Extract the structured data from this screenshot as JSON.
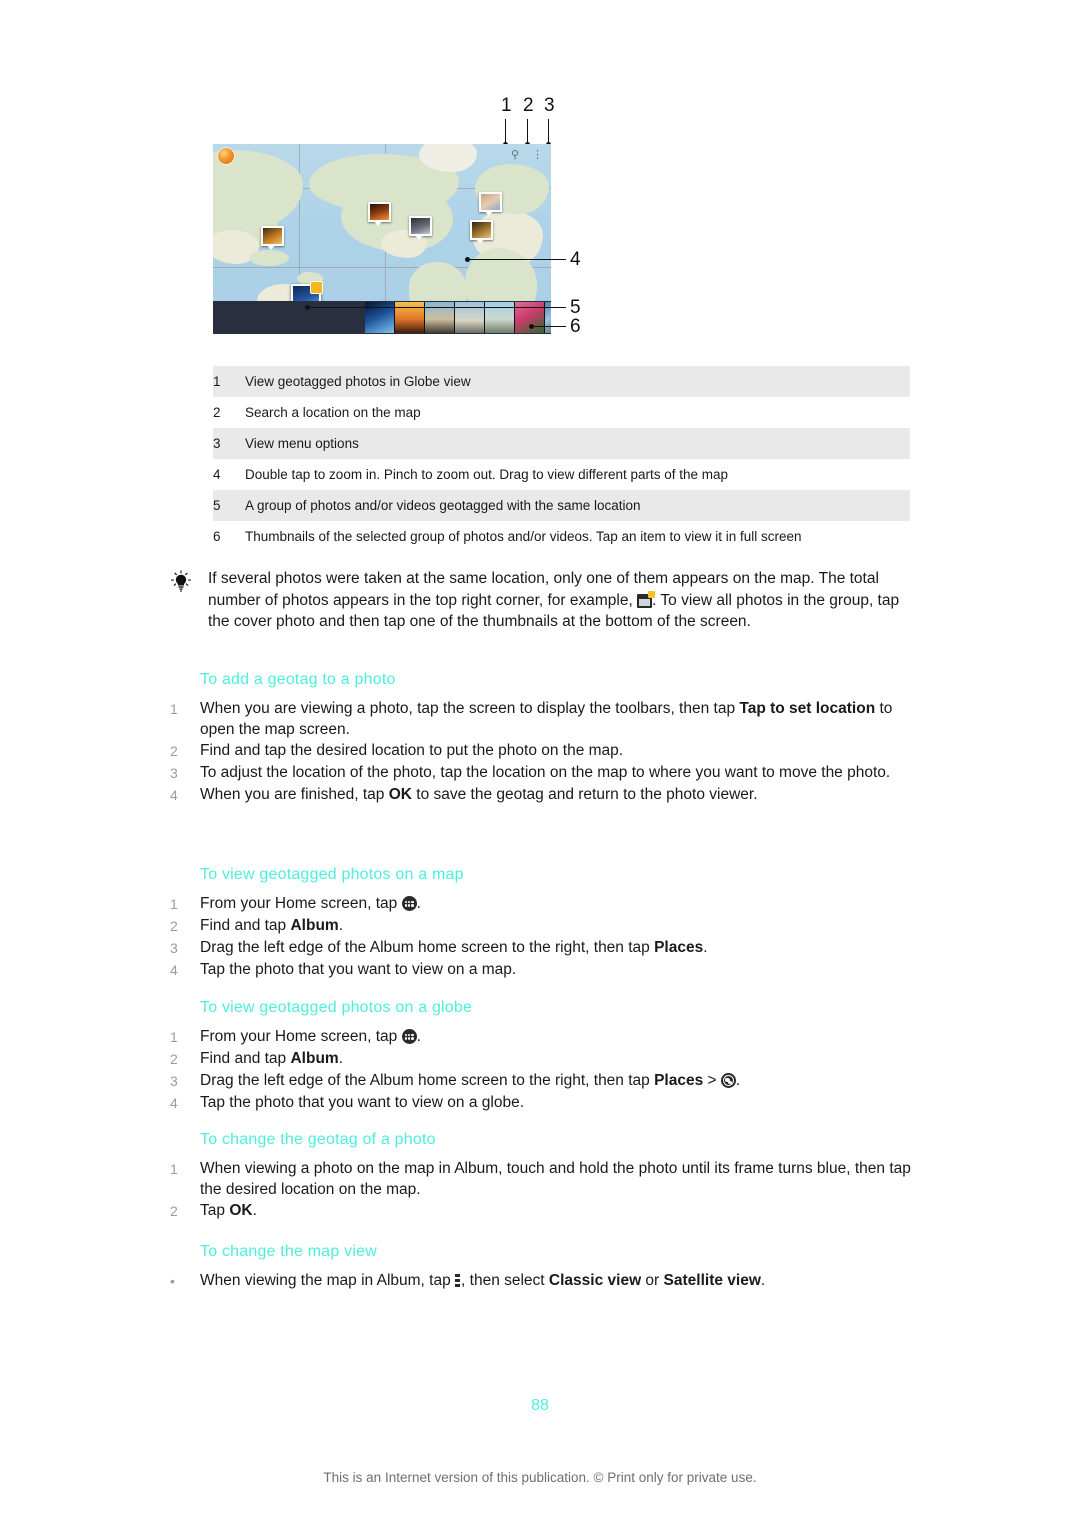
{
  "figure": {
    "callouts_top": [
      "1",
      "2",
      "3"
    ],
    "callouts_right": [
      "4",
      "5",
      "6"
    ],
    "map_label": "globe-button",
    "icons": {
      "globe": "globe-icon",
      "search": "search-icon",
      "menu": "menu-icon"
    }
  },
  "key_table": {
    "rows": [
      {
        "num": "1",
        "text": "View geotagged photos in Globe view"
      },
      {
        "num": "2",
        "text": "Search a location on the map"
      },
      {
        "num": "3",
        "text": "View menu options"
      },
      {
        "num": "4",
        "text": "Double tap to zoom in. Pinch to zoom out. Drag to view different parts of the map"
      },
      {
        "num": "5",
        "text": "A group of photos and/or videos geotagged with the same location"
      },
      {
        "num": "6",
        "text": "Thumbnails of the selected group of photos and/or videos. Tap an item to view it in full screen"
      }
    ]
  },
  "tip": {
    "icon": "lightbulb-icon",
    "part1": "If several photos were taken at the same location, only one of them appears on the map. The total number of photos appears in the top right corner, for example, ",
    "part2": ". To view all photos in the group, tap the cover photo and then tap one of the thumbnails at the bottom of the screen."
  },
  "sections": [
    {
      "heading": "To add a geotag to a photo",
      "steps": [
        {
          "marker": "1",
          "before": "When you are viewing a photo, tap the screen to display the toolbars, then tap ",
          "bold": "Tap to set location",
          "after": " to open the map screen."
        },
        {
          "marker": "2",
          "before": "Find and tap the desired location to put the photo on the map.",
          "bold": "",
          "after": ""
        },
        {
          "marker": "3",
          "before": "To adjust the location of the photo, tap the location on the map to where you want to move the photo.",
          "bold": "",
          "after": ""
        },
        {
          "marker": "4",
          "before": "When you are finished, tap ",
          "bold": "OK",
          "after": " to save the geotag and return to the photo viewer."
        }
      ]
    },
    {
      "heading": "To view geotagged photos on a map",
      "steps": [
        {
          "marker": "1",
          "before": "From your Home screen, tap ",
          "icon": "app-drawer-icon",
          "after": "."
        },
        {
          "marker": "2",
          "before": "Find and tap ",
          "bold": "Album",
          "after": "."
        },
        {
          "marker": "3",
          "before": "Drag the left edge of the Album home screen to the right, then tap ",
          "bold": "Places",
          "after": "."
        },
        {
          "marker": "4",
          "before": "Tap the photo that you want to view on a map.",
          "bold": "",
          "after": ""
        }
      ]
    },
    {
      "heading": "To view geotagged photos on a globe",
      "steps": [
        {
          "marker": "1",
          "before": "From your Home screen, tap ",
          "icon": "app-drawer-icon",
          "after": "."
        },
        {
          "marker": "2",
          "before": "Find and tap ",
          "bold": "Album",
          "after": "."
        },
        {
          "marker": "3",
          "before": "Drag the left edge of the Album home screen to the right, then tap ",
          "bold": "Places",
          "mid": " > ",
          "icon": "globe-icon",
          "after": "."
        },
        {
          "marker": "4",
          "before": "Tap the photo that you want to view on a globe.",
          "bold": "",
          "after": ""
        }
      ]
    },
    {
      "heading": "To change the geotag of a photo",
      "steps": [
        {
          "marker": "1",
          "before": "When viewing a photo on the map in Album, touch and hold the photo until its frame turns blue, then tap the desired location on the map.",
          "bold": "",
          "after": ""
        },
        {
          "marker": "2",
          "before": "Tap ",
          "bold": "OK",
          "after": "."
        }
      ]
    },
    {
      "heading": "To change the map view",
      "steps": [
        {
          "marker": "•",
          "before": "When viewing the map in Album, tap ",
          "icon": "menu-dots-icon",
          "mid": ", then select ",
          "bold": "Classic view",
          "mid2": " or ",
          "bold2": "Satellite view",
          "after": "."
        }
      ]
    }
  ],
  "page_number": "88",
  "footer": "This is an Internet version of this publication. © Print only for private use.",
  "colors": {
    "heading": "#4deedc",
    "table_shade": "#e9e9e9",
    "marker": "#9b9b9b",
    "footer_text": "#6f6f6f"
  }
}
